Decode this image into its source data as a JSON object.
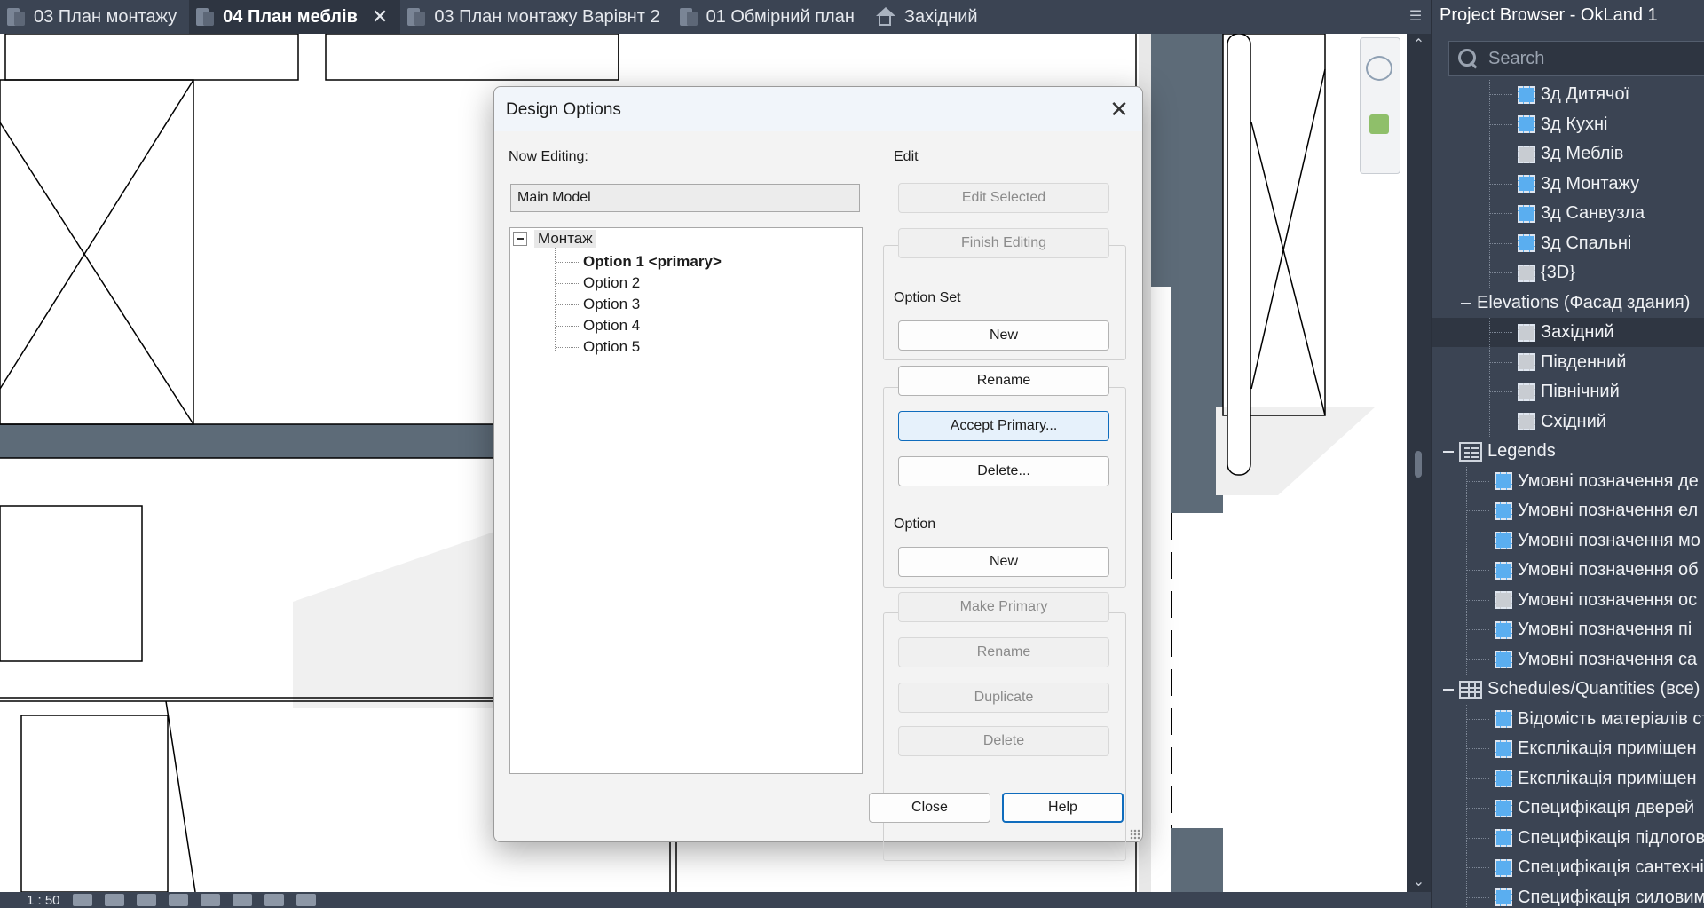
{
  "tabs": [
    {
      "label": "03 План монтажу",
      "active": false,
      "icon": "view-plan-icon"
    },
    {
      "label": "04 План меблів",
      "active": true,
      "icon": "view-plan-icon"
    },
    {
      "label": "03 План монтажу  Варівнт 2",
      "active": false,
      "icon": "view-plan-icon"
    },
    {
      "label": "01 Обмірний план",
      "active": false,
      "icon": "view-plan-icon"
    },
    {
      "label": "Західний",
      "active": false,
      "icon": "elevation-home-icon"
    }
  ],
  "status_bar": {
    "scale": "1 : 50"
  },
  "project_browser": {
    "title": "Project Browser - OkLand 1",
    "search_placeholder": "Search",
    "rows": [
      {
        "label": "3д Дитячої",
        "icon": "blue"
      },
      {
        "label": "3д Кухні",
        "icon": "blue"
      },
      {
        "label": "3д Меблів",
        "icon": "grey"
      },
      {
        "label": "3д Монтажу",
        "icon": "blue"
      },
      {
        "label": "3д Санвузла",
        "icon": "blue"
      },
      {
        "label": "3д Спальні",
        "icon": "blue"
      },
      {
        "label": "{3D}",
        "icon": "grey"
      },
      {
        "label": "Elevations (Фасад здания)",
        "icon": "none"
      },
      {
        "label": "Західний",
        "icon": "grey"
      },
      {
        "label": "Південний",
        "icon": "grey"
      },
      {
        "label": "Північний",
        "icon": "grey"
      },
      {
        "label": "Східний",
        "icon": "grey"
      },
      {
        "label": "Legends",
        "icon": "legend"
      },
      {
        "label": "Умовні позначення де",
        "icon": "blue"
      },
      {
        "label": "Умовні позначення ел",
        "icon": "blue"
      },
      {
        "label": "Умовні позначення мо",
        "icon": "blue"
      },
      {
        "label": "Умовні позначення об",
        "icon": "blue"
      },
      {
        "label": "Умовні позначення ос",
        "icon": "grey"
      },
      {
        "label": "Умовні позначення пі",
        "icon": "blue"
      },
      {
        "label": "Умовні позначення са",
        "icon": "blue"
      },
      {
        "label": "Schedules/Quantities (все)",
        "icon": "schedule"
      },
      {
        "label": "Відомість матеріалів ст",
        "icon": "blue"
      },
      {
        "label": "Експлікація приміщен",
        "icon": "blue"
      },
      {
        "label": "Експлікація приміщен",
        "icon": "blue"
      },
      {
        "label": "Специфікація дверей",
        "icon": "blue"
      },
      {
        "label": "Специфікація підлогов",
        "icon": "blue"
      },
      {
        "label": "Специфікація сантехні",
        "icon": "blue"
      },
      {
        "label": "Специфікація силовим",
        "icon": "blue"
      }
    ]
  },
  "dialog": {
    "title": "Design Options",
    "now_editing_label": "Now Editing:",
    "now_editing_value": "Main Model",
    "tree": {
      "root": "Монтаж",
      "items": [
        {
          "label": "Option 1  <primary>",
          "primary": true
        },
        {
          "label": "Option 2",
          "primary": false
        },
        {
          "label": "Option 3",
          "primary": false
        },
        {
          "label": "Option 4",
          "primary": false
        },
        {
          "label": "Option 5",
          "primary": false
        }
      ]
    },
    "edit_group": {
      "title": "Edit",
      "edit_selected": "Edit Selected",
      "finish_editing": "Finish Editing"
    },
    "option_set_group": {
      "title": "Option Set",
      "new": "New",
      "rename": "Rename",
      "accept_primary": "Accept Primary...",
      "delete": "Delete..."
    },
    "option_group": {
      "title": "Option",
      "new": "New",
      "make_primary": "Make Primary",
      "rename": "Rename",
      "duplicate": "Duplicate",
      "delete": "Delete"
    },
    "close": "Close",
    "help": "Help"
  }
}
